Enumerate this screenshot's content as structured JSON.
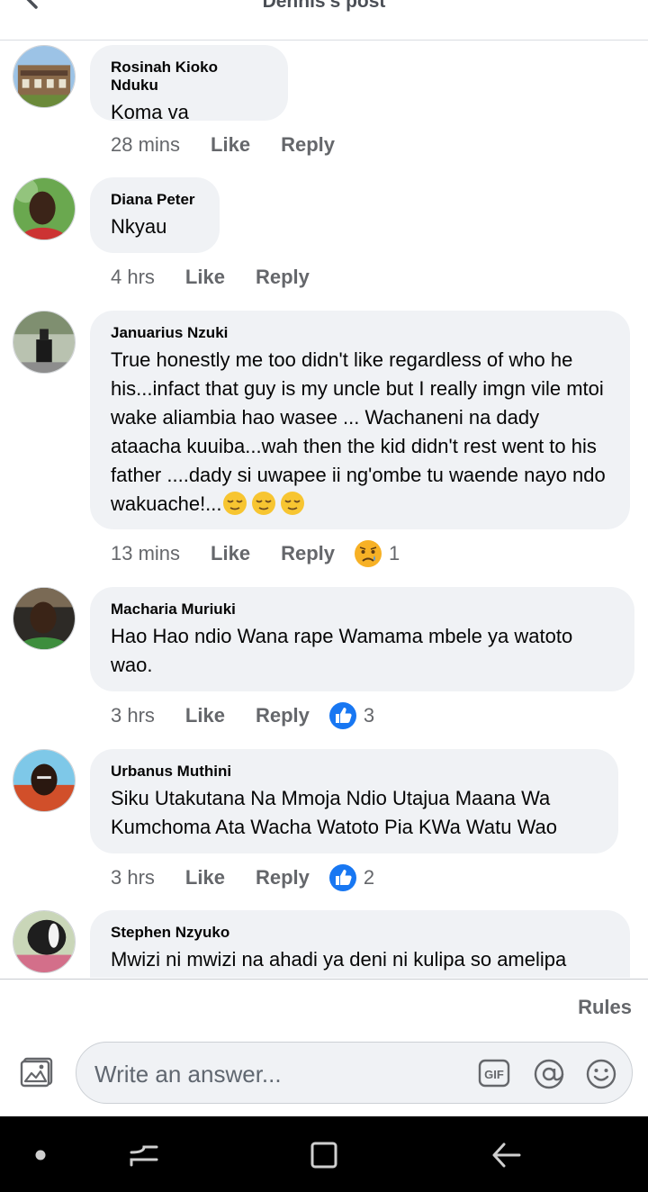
{
  "header": {
    "title": "Dennis's post"
  },
  "comments": [
    {
      "author": "Rosinah Kioko Nduku",
      "text": "Koma va",
      "time": "28 mins",
      "like": "Like",
      "reply": "Reply"
    },
    {
      "author": "Diana Peter",
      "text": "Nkyau",
      "time": "4 hrs",
      "like": "Like",
      "reply": "Reply"
    },
    {
      "author": "Januarius Nzuki",
      "text": "True honestly me too didn't like regardless of who he his...infact that guy is my uncle but I really imgn vile mtoi wake aliambia hao wasee ... Wachaneni na dady ataacha kuuiba...wah then the kid didn't rest went to his father ....dady si uwapee ii ng'ombe tu waende nayo ndo wakuache!...",
      "emojis": [
        "relieved-face-icon",
        "relieved-face-icon",
        "relieved-face-icon"
      ],
      "time": "13 mins",
      "like": "Like",
      "reply": "Reply",
      "reaction": {
        "icon": "sad-face-icon",
        "count": "1"
      }
    },
    {
      "author": "Macharia Muriuki",
      "text": "Hao Hao ndio Wana rape Wamama mbele ya watoto wao.",
      "time": "3 hrs",
      "like": "Like",
      "reply": "Reply",
      "reaction": {
        "icon": "thumbs-up-icon",
        "count": "3"
      }
    },
    {
      "author": "Urbanus Muthini",
      "text": "Siku Utakutana Na Mmoja Ndio Utajua Maana Wa Kumchoma Ata Wacha Watoto Pia KWa Watu Wao",
      "time": "3 hrs",
      "like": "Like",
      "reply": "Reply",
      "reaction": {
        "icon": "thumbs-up-icon",
        "count": "2"
      }
    },
    {
      "author": "Stephen Nzyuko",
      "text": "Mwizi ni mwizi na ahadi ya deni ni kulipa so amelipa"
    }
  ],
  "footer": {
    "rules": "Rules",
    "input_placeholder": "Write an answer..."
  },
  "colors": {
    "bubble": "#f0f2f5",
    "secondary_text": "#65676b",
    "like_blue": "#1877f2",
    "sad_yellow": "#f7b125"
  }
}
